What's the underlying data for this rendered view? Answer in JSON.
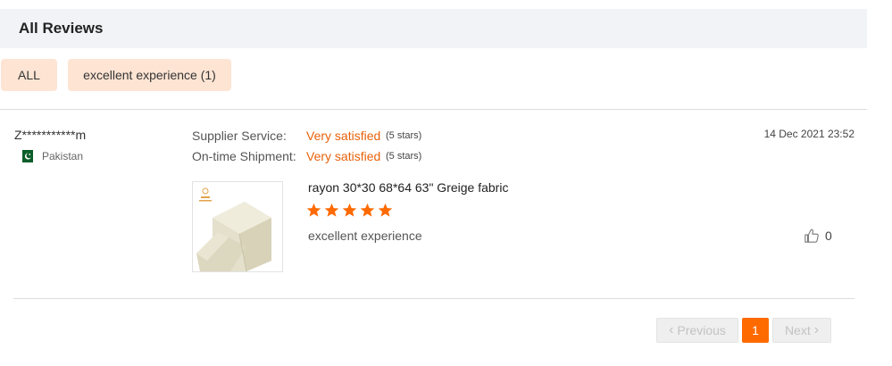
{
  "header": {
    "title": "All Reviews"
  },
  "filters": [
    {
      "label": "ALL"
    },
    {
      "label": "excellent experience (1)"
    }
  ],
  "review": {
    "reviewer": "Z***********m",
    "country": "Pakistan",
    "timestamp": "14 Dec 2021 23:52",
    "ratings": [
      {
        "label": "Supplier Service:",
        "value": "Very satisfied",
        "stars_text": "(5 stars)"
      },
      {
        "label": "On-time Shipment:",
        "value": "Very satisfied",
        "stars_text": "(5 stars)"
      }
    ],
    "product_title": "rayon 30*30 68*64 63\" Greige fabric",
    "star_rating": 5,
    "text": "excellent experience",
    "likes": "0"
  },
  "pagination": {
    "prev_label": "Previous",
    "current_page": "1",
    "next_label": "Next"
  },
  "colors": {
    "accent": "#ff6a00",
    "rating_text": "#e8620c",
    "tag_bg": "#fde4d3",
    "header_bg": "#f2f3f7"
  },
  "icons": {
    "flag": "pakistan-flag-icon",
    "star": "star-icon",
    "like": "thumbs-up-icon",
    "prev": "chevron-left-icon",
    "next": "chevron-right-icon"
  }
}
